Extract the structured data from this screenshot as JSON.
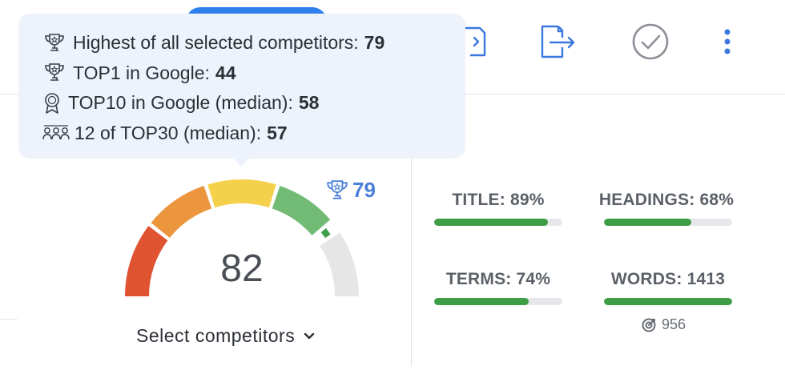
{
  "tooltip": {
    "rows": [
      {
        "icon": "trophy-icon",
        "label": "Highest of all selected competitors:",
        "value": "79"
      },
      {
        "icon": "trophy-icon",
        "label": "TOP1 in Google:",
        "value": "44"
      },
      {
        "icon": "award-badge-icon",
        "label": "TOP10 in Google (median):",
        "value": "58"
      },
      {
        "icon": "group-icon",
        "label": "12 of TOP30 (median):",
        "value": "57"
      }
    ]
  },
  "toolbar": {
    "icons": [
      "document-export-icon",
      "file-export-icon",
      "check-circle-icon",
      "more-vertical-icon"
    ]
  },
  "gauge": {
    "score": "82",
    "score_value": 82,
    "best_competitor": "79",
    "best_icon": "trophy-icon",
    "segment_colors": [
      "#e05331",
      "#eb963d",
      "#f5d04a",
      "#72bb74",
      "#3e9e45",
      "#e6e6e6"
    ]
  },
  "select_competitors": {
    "label": "Select competitors",
    "icon": "chevron-down-icon"
  },
  "metrics": [
    {
      "id": "title",
      "label": "TITLE: 89%",
      "fill": 0.89
    },
    {
      "id": "headings",
      "label": "HEADINGS: 68%",
      "fill": 0.68
    },
    {
      "id": "terms",
      "label": "TERMS: 74%",
      "fill": 0.74
    },
    {
      "id": "words",
      "label": "WORDS: 1413",
      "fill": 1.0
    }
  ],
  "word_target": {
    "icon": "target-icon",
    "value": "956"
  },
  "colors": {
    "accent": "#2f80ed",
    "icon_blue": "#4a7fd8",
    "bar_green": "#3e9e45",
    "tooltip_bg": "#eef2fa"
  }
}
